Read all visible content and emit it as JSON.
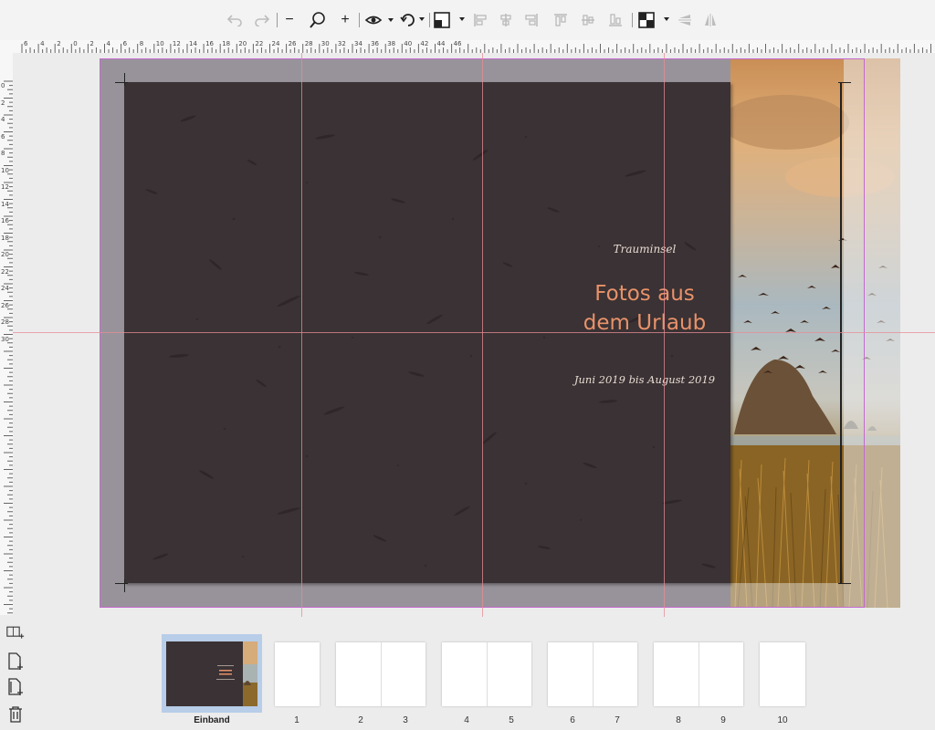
{
  "toolbar": {
    "buttons": [
      {
        "name": "undo-icon",
        "enabled": false
      },
      {
        "name": "redo-icon",
        "enabled": false
      },
      {
        "name": "zoom-out-icon",
        "enabled": true
      },
      {
        "name": "zoom-icon",
        "enabled": true
      },
      {
        "name": "zoom-in-icon",
        "enabled": true
      },
      {
        "name": "view-icon",
        "enabled": true
      },
      {
        "name": "rotate-icon",
        "enabled": true
      },
      {
        "name": "arrange-icon",
        "enabled": true
      },
      {
        "name": "align-left-icon",
        "enabled": false
      },
      {
        "name": "align-center-icon",
        "enabled": false
      },
      {
        "name": "align-right-icon",
        "enabled": false
      },
      {
        "name": "align-top-icon",
        "enabled": false
      },
      {
        "name": "align-middle-icon",
        "enabled": false
      },
      {
        "name": "align-bottom-icon",
        "enabled": false
      },
      {
        "name": "distribute-icon",
        "enabled": true
      },
      {
        "name": "flip-vertical-icon",
        "enabled": false
      },
      {
        "name": "flip-horizontal-icon",
        "enabled": false
      }
    ],
    "zoom_out_label": "−",
    "zoom_in_label": "+"
  },
  "ruler": {
    "top_labels": [
      "6",
      "4",
      "2",
      "0",
      "2",
      "4",
      "6",
      "8",
      "10",
      "12",
      "14",
      "16",
      "18",
      "20",
      "22",
      "24",
      "26",
      "28",
      "30",
      "32",
      "34",
      "36",
      "38",
      "40",
      "42",
      "44",
      "46"
    ],
    "left_labels": [
      "0",
      "2",
      "4",
      "6",
      "8",
      "10",
      "12",
      "14",
      "16",
      "18",
      "20",
      "22",
      "24",
      "26",
      "28",
      "30"
    ]
  },
  "cover": {
    "subtitle": "Trauminsel",
    "title_line1": "Fotos aus",
    "title_line2": "dem Urlaub",
    "dates": "Juni 2019 bis August 2019",
    "title_color": "#e8926a",
    "background_color": "#3a3234"
  },
  "page_strip": {
    "tools": [
      "add-spread-icon",
      "add-page-icon",
      "duplicate-page-icon",
      "delete-icon"
    ],
    "cover_label": "Einband",
    "page_labels": [
      "1",
      "2",
      "3",
      "4",
      "5",
      "6",
      "7",
      "8",
      "9",
      "10"
    ]
  },
  "colors": {
    "guide": "#e88c96",
    "frame": "#c46ad0",
    "selection": "#b7cde8"
  }
}
